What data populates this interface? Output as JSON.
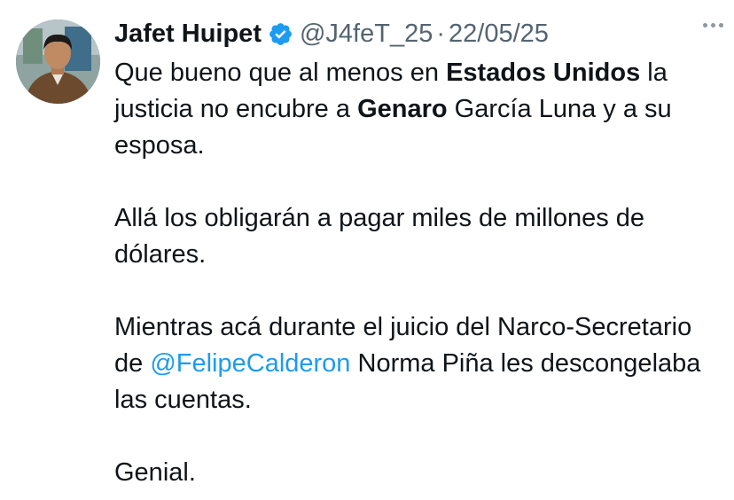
{
  "author": {
    "name": "Jafet Huipet",
    "handle": "@J4feT_25",
    "separator": "·",
    "date": "22/05/25",
    "avatar_icon": "profile-photo",
    "verified_icon": "verified-badge-icon",
    "verified_color": "#1d9bf0"
  },
  "more_icon": "more-options-icon",
  "tweet": {
    "p1": {
      "s1": "Que bueno que al menos en ",
      "b1": "Estados Unidos",
      "s2": " la justicia no encubre a ",
      "b2": "Genaro",
      "s3": " García Luna y a su esposa."
    },
    "p2": "Allá los obligarán a pagar miles de millones de dólares.",
    "p3": {
      "s1": "Mientras acá durante el juicio del Narco-Secretario de ",
      "mention": "@FelipeCalderon",
      "s2": " Norma Piña les descongelaba las cuentas."
    },
    "p4": "Genial."
  },
  "colors": {
    "text": "#0f1419",
    "secondary": "#536471",
    "link": "#1d9bf0",
    "background": "#ffffff"
  }
}
